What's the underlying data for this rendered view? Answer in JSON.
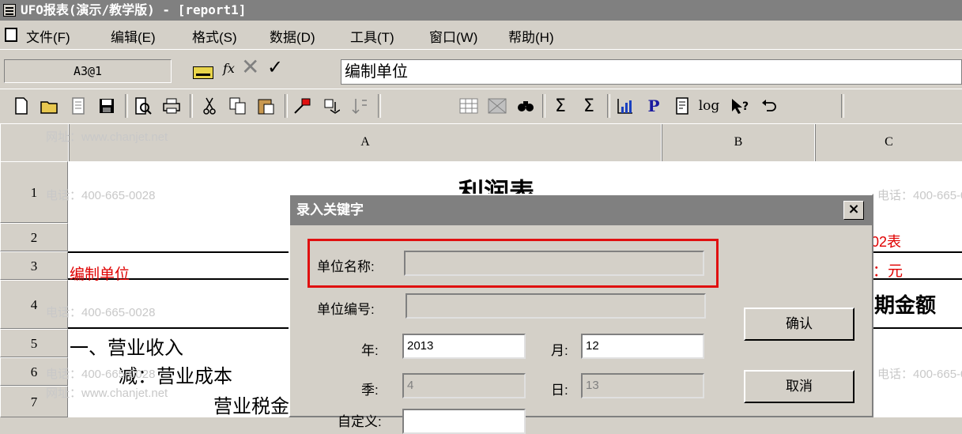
{
  "window": {
    "title": "UFO报表(演示/教学版) - [report1]"
  },
  "menu": {
    "items": [
      {
        "label": "文件(F)"
      },
      {
        "label": "编辑(E)"
      },
      {
        "label": "格式(S)"
      },
      {
        "label": "数据(D)"
      },
      {
        "label": "工具(T)"
      },
      {
        "label": "窗口(W)"
      },
      {
        "label": "帮助(H)"
      }
    ]
  },
  "formula_bar": {
    "cell_ref": "A3@1",
    "fx_label": "fx",
    "content": "编制单位"
  },
  "toolbar": {
    "icons": [
      "new-file-icon",
      "open-folder-icon",
      "document-icon",
      "save-icon",
      "print-preview-icon",
      "print-icon",
      "cut-icon",
      "copy-icon",
      "paste-icon",
      "format-painter-icon",
      "insert-icon",
      "sort-icon",
      "border-grid-icon",
      "pattern-icon",
      "find-icon",
      "sum-icon",
      "sum-down-icon",
      "chart-icon",
      "p-icon",
      "page-icon",
      "log-icon",
      "help-pointer-icon",
      "undo-icon"
    ],
    "p_label": "P",
    "log_label": "log",
    "sum_label": "Σ",
    "sum2_label": "Σ"
  },
  "columns": [
    "A",
    "B",
    "C"
  ],
  "rows": [
    "1",
    "2",
    "3",
    "4",
    "5",
    "6",
    "7"
  ],
  "sheet": {
    "title_partial": "利润表",
    "form_number_partial": "02表",
    "unit_partial": "：元",
    "unit_label": "编制单位",
    "period_amount_partial": "期金额",
    "row5": "一、营业收入",
    "row6": "减：营业成本",
    "row7_partial": "营业税金"
  },
  "watermark": {
    "phone": "电话：400-665-0028",
    "site": "网址：www.chanjet.net"
  },
  "dialog": {
    "title": "录入关键字",
    "close_label": "×",
    "fields": {
      "unit_name_label": "单位名称:",
      "unit_name_value": "",
      "unit_no_label": "单位编号:",
      "unit_no_value": "",
      "year_label": "年:",
      "year_value": "2013",
      "month_label": "月:",
      "month_value": "12",
      "quarter_label": "季:",
      "quarter_value": "4",
      "day_label": "日:",
      "day_value": "13",
      "custom_label_partial": "自定义:"
    },
    "buttons": {
      "confirm": "确认",
      "cancel": "取消"
    },
    "highlight_color": "#e01010"
  }
}
